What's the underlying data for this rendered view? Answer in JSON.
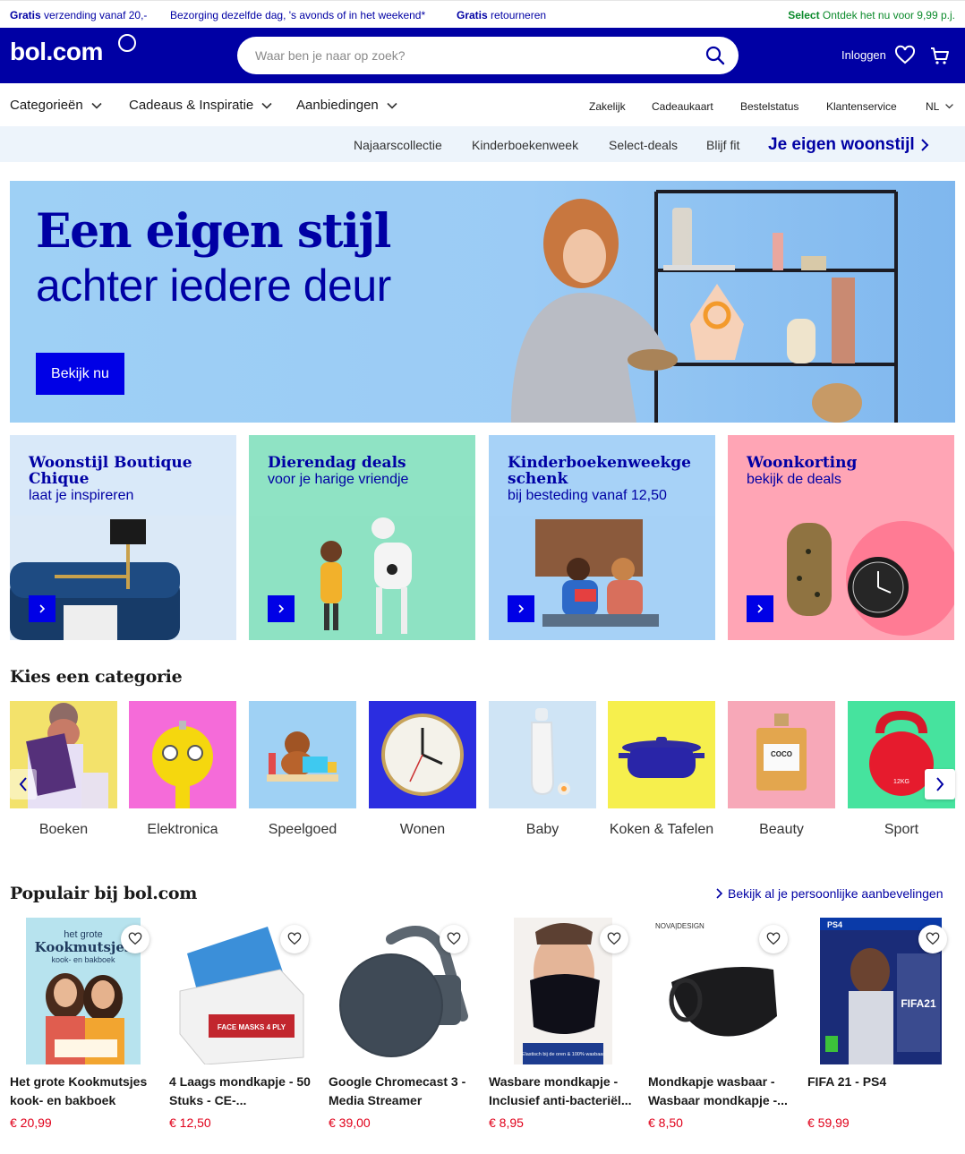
{
  "usp": {
    "shipping_bold": "Gratis",
    "shipping_text": " verzending vanaf 20,-",
    "delivery": "Bezorging dezelfde dag, 's avonds of in het weekend*",
    "returns_bold": "Gratis",
    "returns_text": " retourneren",
    "select_bold": "Select",
    "select_text": " Ontdek het nu voor 9,99 p.j."
  },
  "header": {
    "logo": "bol.com",
    "search_placeholder": "Waar ben je naar op zoek?",
    "login": "Inloggen"
  },
  "nav": {
    "main": [
      "Categorieën",
      "Cadeaus & Inspiratie",
      "Aanbiedingen"
    ],
    "secondary": [
      "Zakelijk",
      "Cadeaukaart",
      "Bestelstatus",
      "Klantenservice",
      "NL"
    ]
  },
  "subnav": {
    "links": [
      "Najaarscollectie",
      "Kinderboekenweek",
      "Select-deals",
      "Blijf fit"
    ],
    "highlight": "Je eigen woonstijl"
  },
  "hero": {
    "title": "Een eigen stijl",
    "subtitle": "achter iedere deur",
    "button": "Bekijk nu"
  },
  "promos": [
    {
      "title": "Woonstijl Boutique Chique",
      "subtitle": "laat je inspireren",
      "bg": "#d9e9f9"
    },
    {
      "title": "Dierendag deals",
      "subtitle": "voor je harige vriendje",
      "bg": "#8fe3c4"
    },
    {
      "title": "Kinderboekenweekge schenk",
      "subtitle": "bij besteding vanaf 12,50",
      "bg": "#a7d2f7"
    },
    {
      "title": "Woonkorting",
      "subtitle": "bekijk de deals",
      "bg": "#ffa5b5"
    }
  ],
  "categories": {
    "heading": "Kies een categorie",
    "items": [
      {
        "label": "Boeken",
        "bg": "#f3e26b"
      },
      {
        "label": "Elektronica",
        "bg": "#f56bd9"
      },
      {
        "label": "Speelgoed",
        "bg": "#9fd1f4"
      },
      {
        "label": "Wonen",
        "bg": "#2b2de0"
      },
      {
        "label": "Baby",
        "bg": "#cfe4f5"
      },
      {
        "label": "Koken & Tafelen",
        "bg": "#f6ef4d"
      },
      {
        "label": "Beauty",
        "bg": "#f7a8b8"
      },
      {
        "label": "Sport",
        "bg": "#46e39e"
      }
    ]
  },
  "popular": {
    "heading": "Populair bij bol.com",
    "reco_link": "Bekijk al je persoonlijke aanbevelingen",
    "products": [
      {
        "name": "Het grote Kookmutsjes kook- en bakboek",
        "price": "€ 20,99"
      },
      {
        "name": "4 Laags mondkapje - 50 Stuks - CE-...",
        "price": "€ 12,50"
      },
      {
        "name": "Google Chromecast 3 - Media Streamer",
        "price": "€ 39,00"
      },
      {
        "name": "Wasbare mondkapje - Inclusief anti-bacteriël...",
        "price": "€ 8,95"
      },
      {
        "name": "Mondkapje wasbaar - Wasbaar mondkapje -...",
        "price": "€ 8,50"
      },
      {
        "name": "FIFA 21 - PS4",
        "price": "€ 59,99"
      }
    ]
  },
  "product_art": {
    "book_title_1": "het grote",
    "book_title_2": "Kookmutsjes",
    "book_title_3": "kook- en bakboek",
    "mask_box": "FACE MASKS 4 PLY",
    "mask_banner": "Elastisch bij de oren & 100% wasbaar",
    "brand": "NOVA|DESIGN",
    "ps4": "PS4",
    "fifa": "FIFA21",
    "clock": "COCO",
    "kettlebell": "12KG"
  },
  "colors": {
    "brand_blue": "#0000a4",
    "button_blue": "#0000e6",
    "price_red": "#e0001a",
    "select_green": "#0b8a2b"
  }
}
